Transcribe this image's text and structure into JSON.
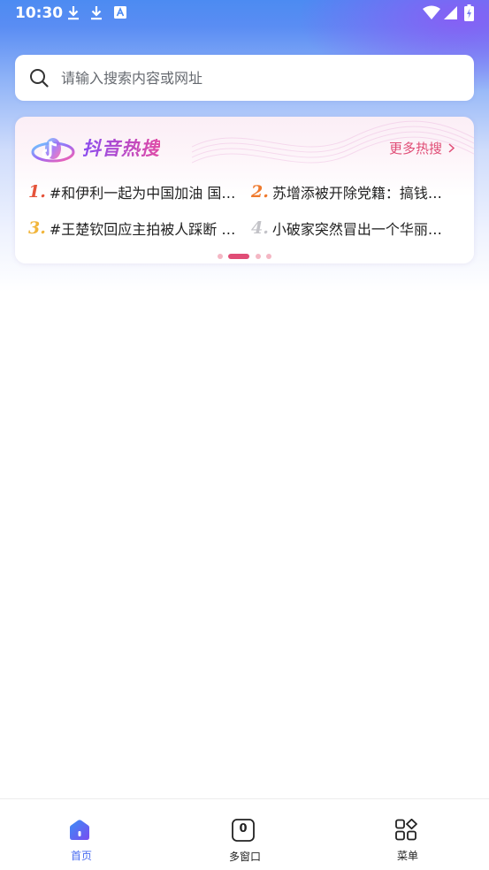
{
  "status_bar": {
    "time": "10:30",
    "icons": [
      "download-icon",
      "download-icon",
      "a-notification-icon",
      "wifi-icon",
      "signal-icon",
      "battery-charging-icon"
    ]
  },
  "search": {
    "placeholder": "请输入搜索内容或网址"
  },
  "hot_search": {
    "title": "抖音热搜",
    "more_label": "更多热搜",
    "items": [
      {
        "rank": "1.",
        "text": "#和伊利一起为中国加油 国…",
        "rank_color": "#e5533a"
      },
      {
        "rank": "2.",
        "text": "苏增添被开除党籍：搞钱…",
        "rank_color": "#ef7a2e"
      },
      {
        "rank": "3.",
        "text": "#王楚钦回应主拍被人踩断 …",
        "rank_color": "#f1b53b"
      },
      {
        "rank": "4.",
        "text": "小破家突然冒出一个华丽…",
        "rank_color": "#c3c3c8"
      }
    ],
    "pager": {
      "pages": 4,
      "active": 1
    }
  },
  "bottom_nav": {
    "items": [
      {
        "label": "首页",
        "icon": "home-icon",
        "active": true
      },
      {
        "label": "多窗口",
        "icon": "tab-count-icon",
        "count": "0",
        "active": false
      },
      {
        "label": "菜单",
        "icon": "menu-grid-icon",
        "active": false
      }
    ]
  },
  "colors": {
    "accent": "#4a6cf0",
    "hot_accent": "#e04d76"
  }
}
